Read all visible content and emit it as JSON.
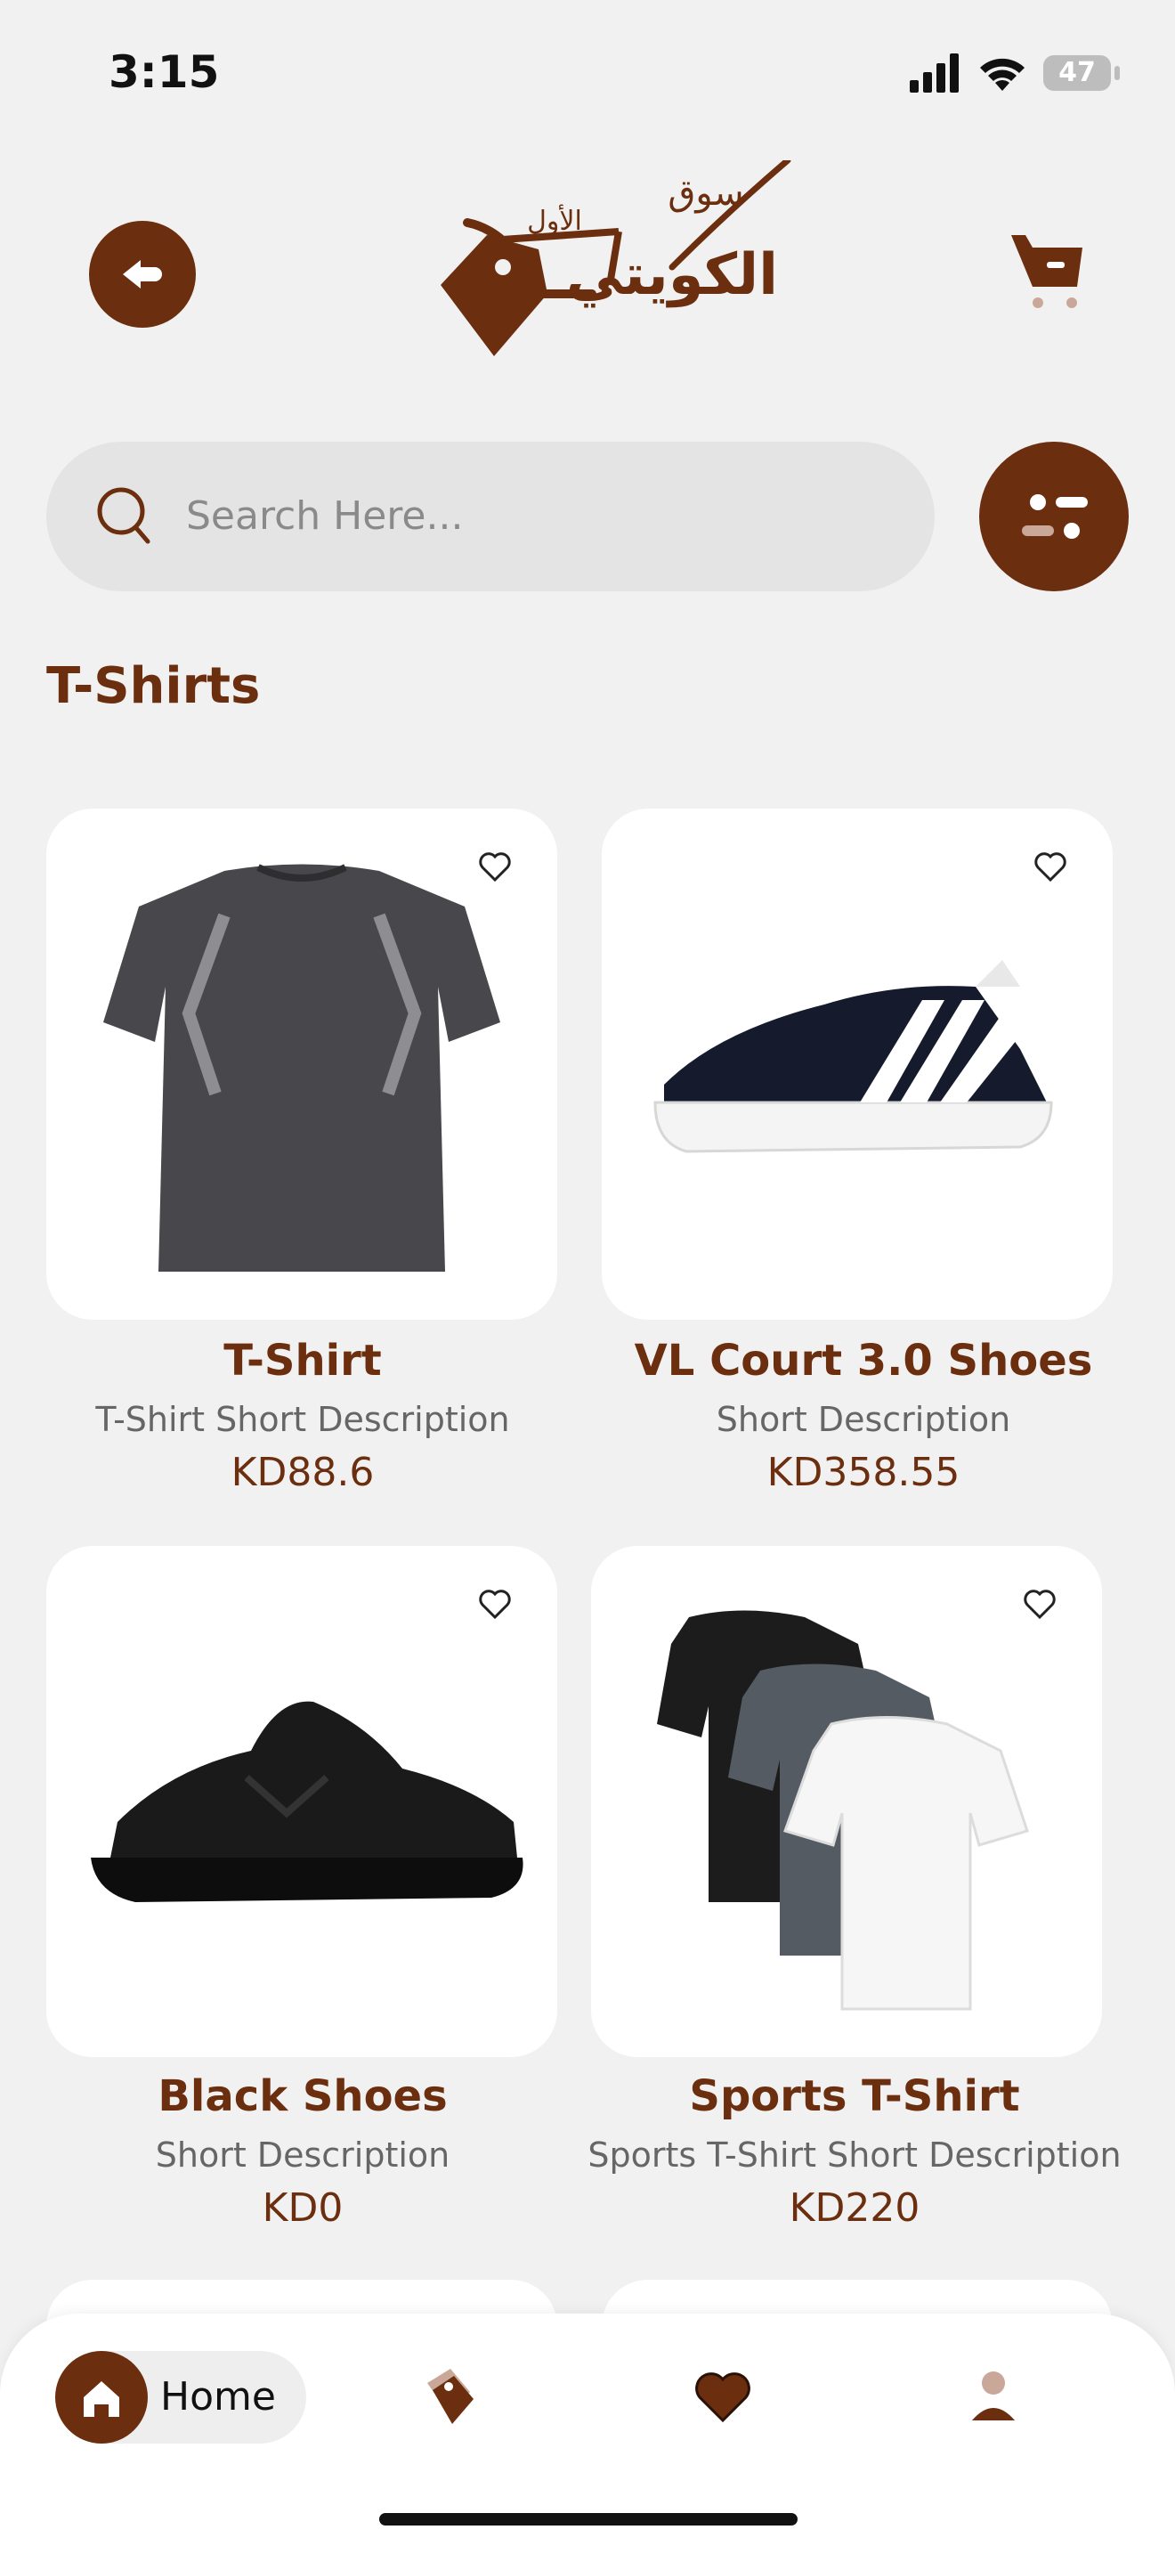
{
  "status_bar": {
    "time": "3:15",
    "battery": "47"
  },
  "header": {
    "logo_text_top": "سوق",
    "logo_text_small": "الأول",
    "logo_text_main": "الكويتي"
  },
  "search": {
    "placeholder": "Search Here..."
  },
  "section": {
    "title": "T-Shirts"
  },
  "products": [
    {
      "name": "T-Shirt",
      "description": "T-Shirt Short Description",
      "price": "KD88.6"
    },
    {
      "name": "VL Court 3.0 Shoes",
      "description": "Short Description",
      "price": "KD358.55"
    },
    {
      "name": "Black Shoes",
      "description": "Short Description",
      "price": "KD0"
    },
    {
      "name": "Sports T-Shirt",
      "description": "Sports T-Shirt Short Description",
      "price": "KD220"
    }
  ],
  "tabbar": {
    "home_label": "Home"
  },
  "colors": {
    "brand": "#6b2e0e",
    "background": "#f2f1f1"
  }
}
